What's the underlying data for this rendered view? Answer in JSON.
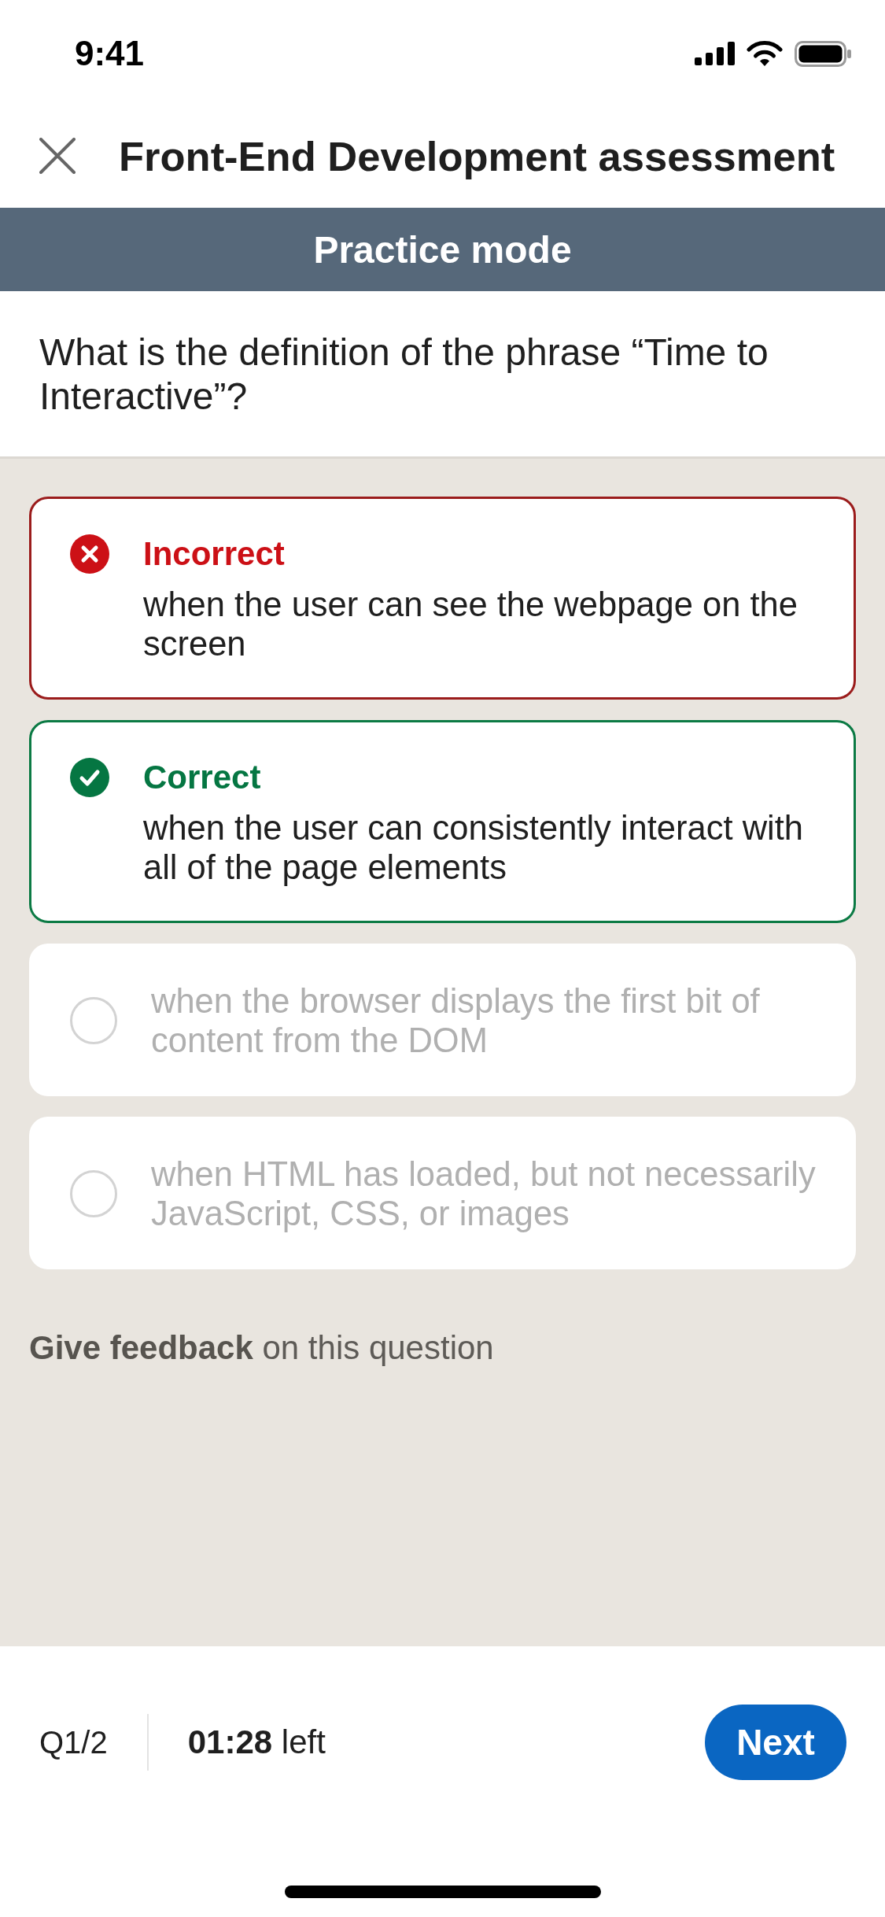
{
  "status_bar": {
    "time": "9:41"
  },
  "header": {
    "title": "Front-End Development assessment"
  },
  "mode_banner": {
    "label": "Practice mode"
  },
  "question": {
    "text": "What is the definition of the phrase “Time to Interactive”?"
  },
  "options": [
    {
      "kind": "incorrect",
      "result": "Incorrect",
      "text": "when the user can see the webpage on the screen",
      "disabled": false
    },
    {
      "kind": "correct",
      "result": "Correct",
      "text": "when the user can consistently interact with all of the page elements",
      "disabled": false
    },
    {
      "kind": "choice",
      "text": "when the browser displays the first bit of content from the DOM",
      "disabled": true,
      "selected": false
    },
    {
      "kind": "choice",
      "text": "when HTML has loaded, but not necessarily JavaScript, CSS, or images",
      "disabled": true,
      "selected": false
    }
  ],
  "feedback": {
    "text": "**Give feedback** on this question"
  },
  "footer": {
    "progress": "Q1/2",
    "timer": "**01:28** left",
    "next_button": "Next"
  }
}
